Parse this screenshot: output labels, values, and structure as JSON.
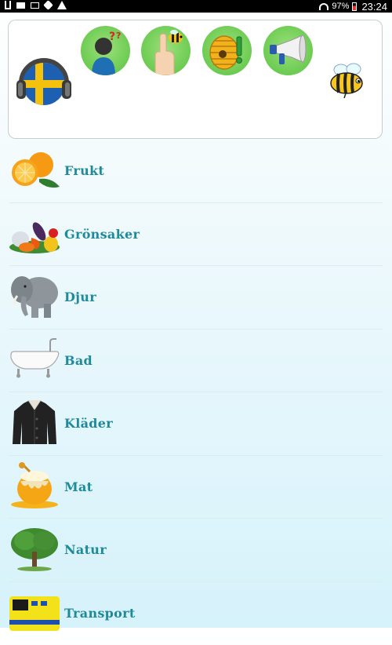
{
  "status_bar": {
    "battery_percent": "97%",
    "time": "23:24",
    "left_icons": [
      "usb-icon",
      "keyboard-icon",
      "message-icon",
      "phone-icon",
      "warning-icon"
    ],
    "right_icons": [
      "wifi-icon",
      "battery-icon"
    ]
  },
  "header": {
    "logo_icon": "sweden-flag-headphones-icon",
    "buttons": [
      {
        "icon": "question-person-icon"
      },
      {
        "icon": "pointing-finger-bee-icon"
      },
      {
        "icon": "beehive-exclamation-icon"
      },
      {
        "icon": "megaphone-icon"
      }
    ],
    "mascot_icon": "bee-mascot-icon",
    "button_color": "#6ccb52"
  },
  "categories": [
    {
      "label": "Frukt",
      "icon": "orange-fruit-icon"
    },
    {
      "label": "Grönsaker",
      "icon": "vegetables-icon"
    },
    {
      "label": "Djur",
      "icon": "elephant-icon"
    },
    {
      "label": "Bad",
      "icon": "bathtub-icon"
    },
    {
      "label": "Kläder",
      "icon": "jacket-icon"
    },
    {
      "label": "Mat",
      "icon": "honey-pot-icon"
    },
    {
      "label": "Natur",
      "icon": "tree-icon"
    },
    {
      "label": "Transport",
      "icon": "ambulance-icon"
    }
  ],
  "theme": {
    "label_color": "#1e8a9a",
    "divider_color": "#d9ecf2"
  }
}
